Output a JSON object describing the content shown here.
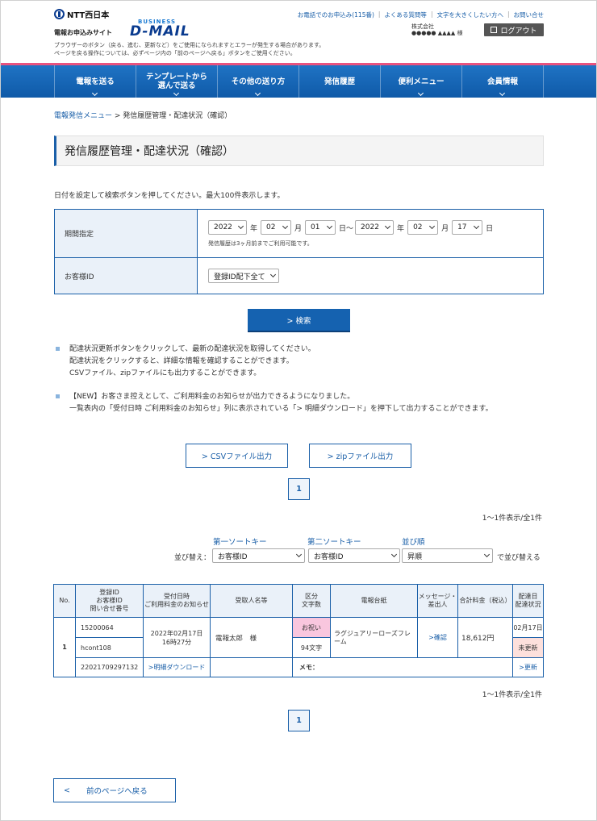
{
  "header": {
    "ntt_logo": "NTT西日本",
    "site_sub": "電報お申込みサイト",
    "site_biz": "BUSINESS",
    "site_name": "D-MAIL",
    "note_line1": "ブラウザーのボタン（戻る、進む、更新など）をご使用になられますとエラーが発生する場合があります。",
    "note_line2": "ページを戻る操作については、必ずページ内の「前のページへ戻る」ボタンをご使用ください。",
    "links": [
      "お電話でのお申込み(115番)",
      "よくある質問等",
      "文字を大きくしたい方へ",
      "お問い合せ"
    ],
    "user_company": "株式会社",
    "user_name": "●●●●● ▲▲▲▲ 様",
    "logout": "ログアウト"
  },
  "nav": {
    "items": [
      "電報を送る",
      "テンプレートから\n選んで送る",
      "その他の送り方",
      "発信履歴",
      "便利メニュー",
      "会員情報"
    ]
  },
  "breadcrumb": {
    "link": "電報発信メニュー",
    "sep": " > ",
    "current": "発信履歴管理・配達状況（確認）"
  },
  "page_title": "発信履歴管理・配達状況（確認）",
  "intro": "日付を設定して検索ボタンを押してください。最大100件表示します。",
  "form": {
    "period_label": "期間指定",
    "from": {
      "year": "2022",
      "month": "02",
      "day": "01"
    },
    "to": {
      "year": "2022",
      "month": "02",
      "day": "17"
    },
    "unit_year": "年",
    "unit_month": "月",
    "unit_day_from": "日～",
    "unit_day_to": "日",
    "hint": "発信履歴は3ヶ月前までご利用可能です。",
    "customer_label": "お客様ID",
    "customer_value": "登録ID配下全て"
  },
  "search_button": "> 検索",
  "notes": [
    [
      "配達状況更新ボタンをクリックして、最新の配達状況を取得してください。",
      "配達状況をクリックすると、詳細な情報を確認することができます。",
      "CSVファイル、zipファイルにも出力することができます。"
    ],
    [
      "【NEW】お客さま控えとして、ご利用料金のお知らせが出力できるようになりました。",
      "一覧表内の「受付日時 ご利用料金のお知らせ」列に表示されている「> 明細ダウンロード」を押下して出力することができます。"
    ]
  ],
  "buttons": {
    "csv": "> CSVファイル出力",
    "zip": "> zipファイル出力",
    "page": "1",
    "back": "前のページへ戻る",
    "back_arrow": "<"
  },
  "count_text": "1～1件表示/全1件",
  "sort": {
    "key1_label": "第一ソートキー",
    "key2_label": "第二ソートキー",
    "order_label": "並び順",
    "prefix": "並び替え：",
    "key1": "お客様ID",
    "key2": "お客様ID",
    "order": "昇順",
    "suffix": "で並び替える"
  },
  "table": {
    "headers": {
      "no": "No.",
      "ids": "登録ID\nお客様ID\n問い合せ番号",
      "accept": "受付日時\nご利用料金のお知らせ",
      "recipient": "受取人名等",
      "kubun": "区分\n文字数",
      "daishi": "電報台紙",
      "message": "メッセージ・\n差出人",
      "total": "合計料金（税込）",
      "delivery": "配達日\n配達状況"
    },
    "row": {
      "no": "1",
      "reg_id": "15200064",
      "cust_id": "hcont108",
      "inquiry": "22021709297132",
      "accept_date": "2022年02月17日",
      "accept_time": "16時27分",
      "download": ">明細ダウンロード",
      "recipient": "電報太郎　様",
      "kubun": "お祝い",
      "chars": "94文字",
      "daishi": "ラグジュアリーローズフレーム",
      "confirm": ">確認",
      "total": "18,612円",
      "delivery_date": "02月17日",
      "status": "未更新",
      "memo": "メモ：",
      "update": ">更新"
    }
  }
}
